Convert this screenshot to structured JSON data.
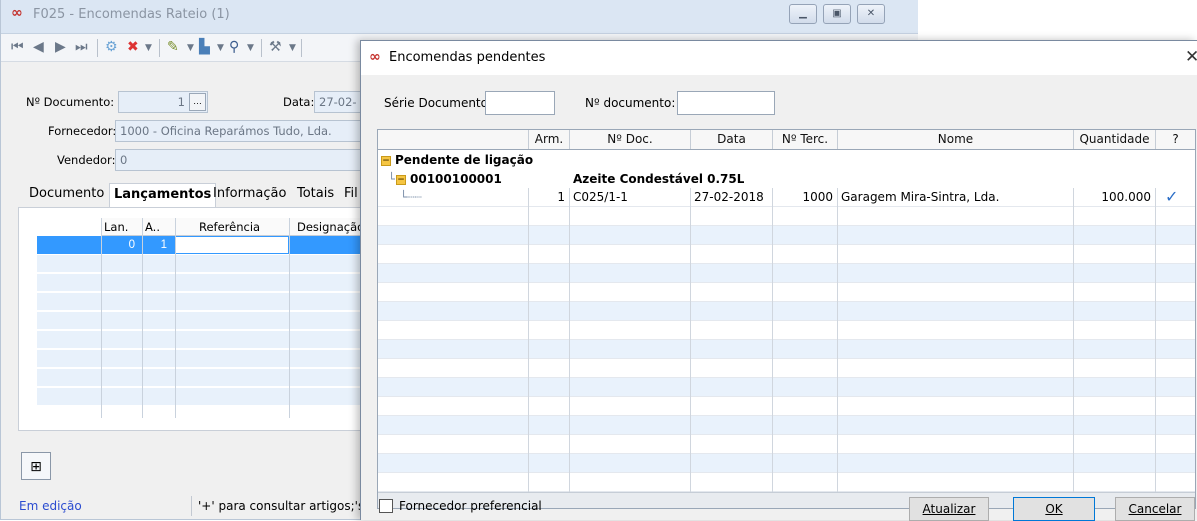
{
  "back_window": {
    "title": "F025 - Encomendas Rateio (1)",
    "fields": {
      "doc_label": "Nº Documento:",
      "doc_value": "1",
      "date_label": "Data:",
      "date_value": "27-02-",
      "supplier_label": "Fornecedor:",
      "supplier_value": "1000 - Oficina Reparámos Tudo, Lda.",
      "seller_label": "Vendedor:",
      "seller_value": "0"
    },
    "tabs": [
      "Documento",
      "Lançamentos",
      "Informação",
      "Totais",
      "Fil"
    ],
    "grid": {
      "columns": [
        "Lan.",
        "A..",
        "Referência",
        "Designação"
      ],
      "row": {
        "lan": "0",
        "a": "1"
      }
    },
    "status": {
      "mode": "Em edição",
      "hint": "'+' para consultar artigos;'s"
    }
  },
  "dialog": {
    "title": "Encomendas pendentes",
    "serie_label": "Série Documento:",
    "serie_value": "",
    "num_label": "Nº documento:",
    "num_value": "",
    "grid": {
      "columns": [
        "",
        "Arm.",
        "Nº Doc.",
        "Data",
        "Nº Terc.",
        "Nome",
        "Quantidade",
        "?"
      ],
      "group_label": "Pendente de ligação",
      "article_code": "00100100001",
      "article_name": "Azeite Condestável 0.75L",
      "rows": [
        {
          "arm": "1",
          "ndoc": "C025/1-1",
          "data": "27-02-2018",
          "nterc": "1000",
          "nome": "Garagem Mira-Sintra, Lda.",
          "quantidade": "100.000",
          "checked": "✓"
        }
      ]
    },
    "checkbox_label": "Fornecedor preferencial",
    "buttons": {
      "refresh": "Atualizar",
      "ok": "OK",
      "cancel": "Cancelar"
    }
  },
  "colors": {
    "accent": "#0078d7",
    "selected_row": "#3399ff",
    "alt_row": "#e9f2fc",
    "status_text": "#2a4bd0"
  }
}
